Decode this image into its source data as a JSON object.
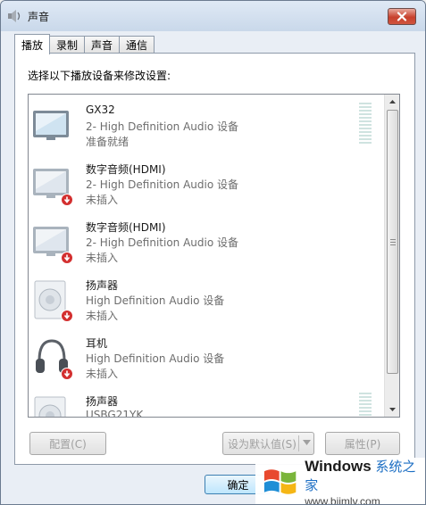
{
  "window": {
    "title": "声音"
  },
  "tabs": [
    {
      "label": "播放"
    },
    {
      "label": "录制"
    },
    {
      "label": "声音"
    },
    {
      "label": "通信"
    }
  ],
  "instruction": "选择以下播放设备来修改设置:",
  "devices": [
    {
      "name": "GX32",
      "description": "2- High Definition Audio 设备",
      "status": "准备就绪",
      "icon": "monitor-icon",
      "disconnected": false,
      "level_meter": true
    },
    {
      "name": "数字音频(HDMI)",
      "description": "2- High Definition Audio 设备",
      "status": "未插入",
      "icon": "monitor-icon",
      "disconnected": true,
      "level_meter": false
    },
    {
      "name": "数字音频(HDMI)",
      "description": "2- High Definition Audio 设备",
      "status": "未插入",
      "icon": "monitor-icon",
      "disconnected": true,
      "level_meter": false
    },
    {
      "name": "扬声器",
      "description": "High Definition Audio 设备",
      "status": "未插入",
      "icon": "speaker-icon",
      "disconnected": true,
      "level_meter": false
    },
    {
      "name": "耳机",
      "description": "High Definition Audio 设备",
      "status": "未插入",
      "icon": "headphones-icon",
      "disconnected": true,
      "level_meter": false
    },
    {
      "name": "扬声器",
      "description": "USBG21YK",
      "status": "",
      "icon": "speaker-icon",
      "disconnected": false,
      "level_meter": true
    }
  ],
  "buttons": {
    "configure": "配置(C)",
    "set_default": "设为默认值(S)",
    "properties": "属性(P)",
    "ok": "确定"
  },
  "watermark": {
    "brand": "Windows",
    "brand_suffix": "系统之家",
    "url": "www.bjjmlv.com"
  },
  "colors": {
    "close_red": "#c7402d",
    "disconnect_red": "#d32f2f",
    "watermark_blue": "#1d6fc4"
  }
}
